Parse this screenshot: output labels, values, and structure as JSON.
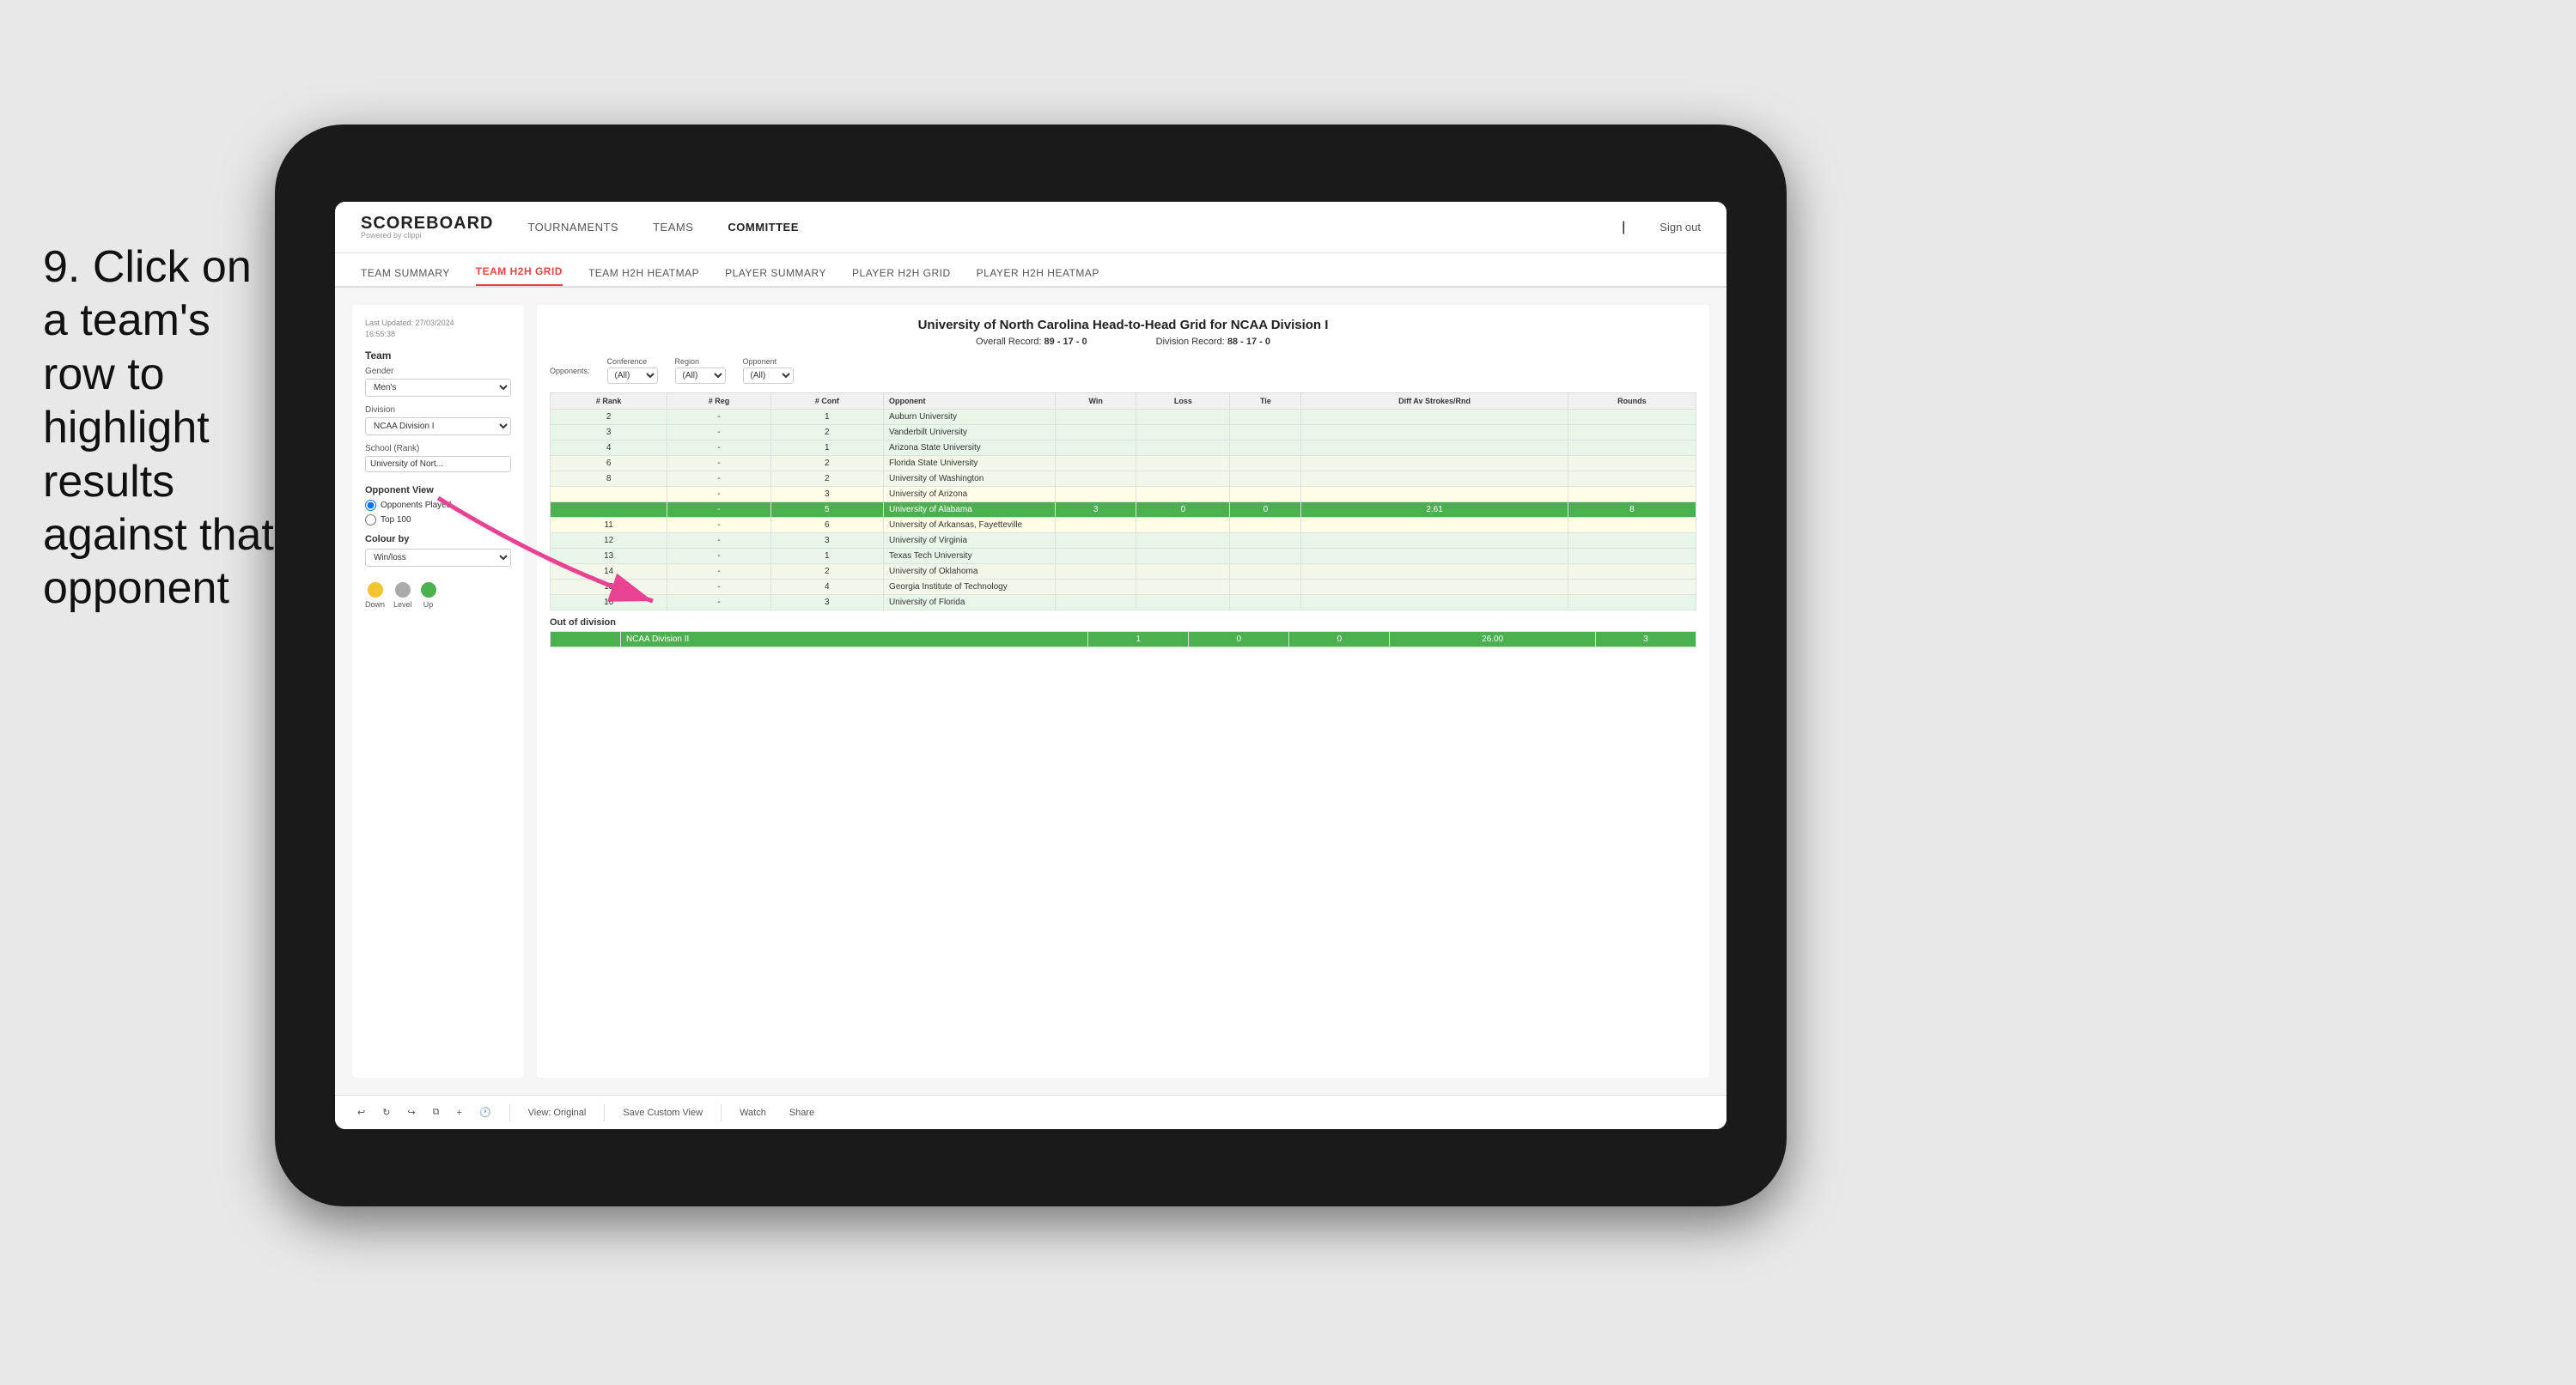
{
  "instruction": {
    "step": "9.",
    "text": "Click on a team's row to highlight results against that opponent"
  },
  "nav": {
    "brand_name": "SCOREBOARD",
    "brand_sub": "Powered by clippi",
    "items": [
      "TOURNAMENTS",
      "TEAMS",
      "COMMITTEE"
    ],
    "sign_out_label": "Sign out",
    "separator": "|"
  },
  "sub_nav": {
    "items": [
      "TEAM SUMMARY",
      "TEAM H2H GRID",
      "TEAM H2H HEATMAP",
      "PLAYER SUMMARY",
      "PLAYER H2H GRID",
      "PLAYER H2H HEATMAP"
    ],
    "active": "TEAM H2H GRID"
  },
  "left_panel": {
    "last_updated_label": "Last Updated: 27/03/2024",
    "last_updated_time": "16:55:38",
    "team_label": "Team",
    "gender_label": "Gender",
    "gender_value": "Men's",
    "division_label": "Division",
    "division_value": "NCAA Division I",
    "school_label": "School (Rank)",
    "school_value": "University of Nort...",
    "opponent_view_label": "Opponent View",
    "opponent_options": [
      "Opponents Played",
      "Top 100"
    ],
    "opponent_selected": "Opponents Played",
    "colour_by_label": "Colour by",
    "colour_by_value": "Win/loss",
    "legend": {
      "down_label": "Down",
      "level_label": "Level",
      "up_label": "Up",
      "down_color": "#f4c430",
      "level_color": "#aaa",
      "up_color": "#4caf50"
    }
  },
  "grid": {
    "title": "University of North Carolina Head-to-Head Grid for NCAA Division I",
    "overall_record_label": "Overall Record:",
    "overall_record": "89 - 17 - 0",
    "division_record_label": "Division Record:",
    "division_record": "88 - 17 - 0",
    "filters": {
      "opponents_label": "Opponents:",
      "conference_label": "Conference",
      "conference_value": "(All)",
      "region_label": "Region",
      "region_value": "(All)",
      "opponent_label": "Opponent",
      "opponent_value": "(All)"
    },
    "table_headers": [
      "# Rank",
      "# Reg",
      "# Conf",
      "Opponent",
      "Win",
      "Loss",
      "Tie",
      "Diff Av Strokes/Rnd",
      "Rounds"
    ],
    "rows": [
      {
        "rank": "2",
        "reg": "-",
        "conf": "1",
        "opponent": "Auburn University",
        "win": "",
        "loss": "",
        "tie": "",
        "diff": "",
        "rounds": "",
        "style": "light-green"
      },
      {
        "rank": "3",
        "reg": "-",
        "conf": "2",
        "opponent": "Vanderbilt University",
        "win": "",
        "loss": "",
        "tie": "",
        "diff": "",
        "rounds": "",
        "style": "light-green"
      },
      {
        "rank": "4",
        "reg": "-",
        "conf": "1",
        "opponent": "Arizona State University",
        "win": "",
        "loss": "",
        "tie": "",
        "diff": "",
        "rounds": "",
        "style": "light-green"
      },
      {
        "rank": "6",
        "reg": "-",
        "conf": "2",
        "opponent": "Florida State University",
        "win": "",
        "loss": "",
        "tie": "",
        "diff": "",
        "rounds": "",
        "style": "lighter-green"
      },
      {
        "rank": "8",
        "reg": "-",
        "conf": "2",
        "opponent": "University of Washington",
        "win": "",
        "loss": "",
        "tie": "",
        "diff": "",
        "rounds": "",
        "style": "lighter-green"
      },
      {
        "rank": "",
        "reg": "-",
        "conf": "3",
        "opponent": "University of Arizona",
        "win": "",
        "loss": "",
        "tie": "",
        "diff": "",
        "rounds": "",
        "style": "light-yellow"
      },
      {
        "rank": "",
        "reg": "-",
        "conf": "5",
        "opponent": "University of Alabama",
        "win": "3",
        "loss": "0",
        "tie": "0",
        "diff": "2.61",
        "rounds": "8",
        "style": "highlighted"
      },
      {
        "rank": "11",
        "reg": "-",
        "conf": "6",
        "opponent": "University of Arkansas, Fayetteville",
        "win": "",
        "loss": "",
        "tie": "",
        "diff": "",
        "rounds": "",
        "style": "light-yellow"
      },
      {
        "rank": "12",
        "reg": "-",
        "conf": "3",
        "opponent": "University of Virginia",
        "win": "",
        "loss": "",
        "tie": "",
        "diff": "",
        "rounds": "",
        "style": "light-green"
      },
      {
        "rank": "13",
        "reg": "-",
        "conf": "1",
        "opponent": "Texas Tech University",
        "win": "",
        "loss": "",
        "tie": "",
        "diff": "",
        "rounds": "",
        "style": "light-green"
      },
      {
        "rank": "14",
        "reg": "-",
        "conf": "2",
        "opponent": "University of Oklahoma",
        "win": "",
        "loss": "",
        "tie": "",
        "diff": "",
        "rounds": "",
        "style": "lighter-green"
      },
      {
        "rank": "15",
        "reg": "-",
        "conf": "4",
        "opponent": "Georgia Institute of Technology",
        "win": "",
        "loss": "",
        "tie": "",
        "diff": "",
        "rounds": "",
        "style": "lighter-green"
      },
      {
        "rank": "16",
        "reg": "-",
        "conf": "3",
        "opponent": "University of Florida",
        "win": "",
        "loss": "",
        "tie": "",
        "diff": "",
        "rounds": "",
        "style": "light-green"
      }
    ],
    "out_of_division_label": "Out of division",
    "out_of_division_row": {
      "division": "NCAA Division II",
      "win": "1",
      "loss": "0",
      "tie": "0",
      "diff": "26.00",
      "rounds": "3",
      "style": "highlighted"
    }
  },
  "toolbar": {
    "view_label": "View: Original",
    "save_label": "Save Custom View",
    "watch_label": "Watch",
    "share_label": "Share"
  }
}
